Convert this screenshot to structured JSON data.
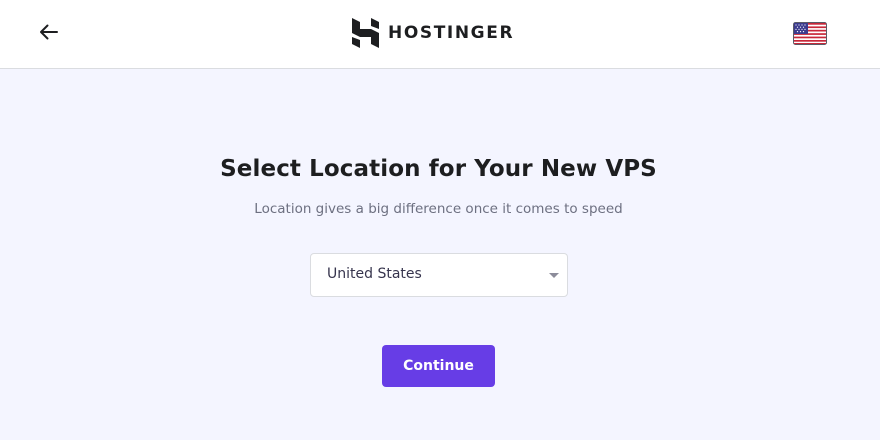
{
  "header": {
    "brand_name": "HOSTINGER",
    "back_icon": "arrow-left-icon",
    "language_icon": "us-flag-icon"
  },
  "main": {
    "title": "Select Location for Your New VPS",
    "subtitle": "Location gives a big difference once it comes to speed",
    "location_select": {
      "selected_value": "United States"
    },
    "continue_label": "Continue"
  },
  "colors": {
    "accent": "#673de6",
    "page_background": "#f4f5ff",
    "header_background": "#ffffff",
    "heading_text": "#1d1e20",
    "muted_text": "#6d7081"
  }
}
